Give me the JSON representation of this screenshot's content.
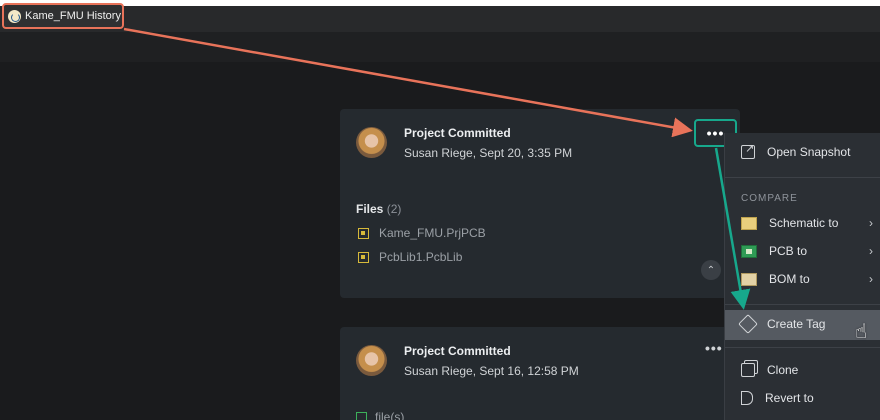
{
  "tab": {
    "title": "Kame_FMU History"
  },
  "commits": [
    {
      "title": "Project Committed",
      "author_time": "Susan Riege, Sept 20, 3:35 PM",
      "files_label": "Files",
      "files_count": "(2)",
      "files": [
        "Kame_FMU.PrjPCB",
        "PcbLib1.PcbLib"
      ]
    },
    {
      "title": "Project Committed",
      "author_time": "Susan Riege, Sept 16, 12:58 PM",
      "files_peek": "file(s)"
    }
  ],
  "menu": {
    "open_snapshot": "Open Snapshot",
    "compare_header": "COMPARE",
    "schematic_to": "Schematic to",
    "pcb_to": "PCB to",
    "bom_to": "BOM to",
    "create_tag": "Create Tag",
    "clone": "Clone",
    "revert_to": "Revert to"
  },
  "colors": {
    "annotation_orange": "#e8735a",
    "annotation_teal": "#17a88c",
    "background": "#1a1b1d",
    "card": "#252a2f"
  }
}
